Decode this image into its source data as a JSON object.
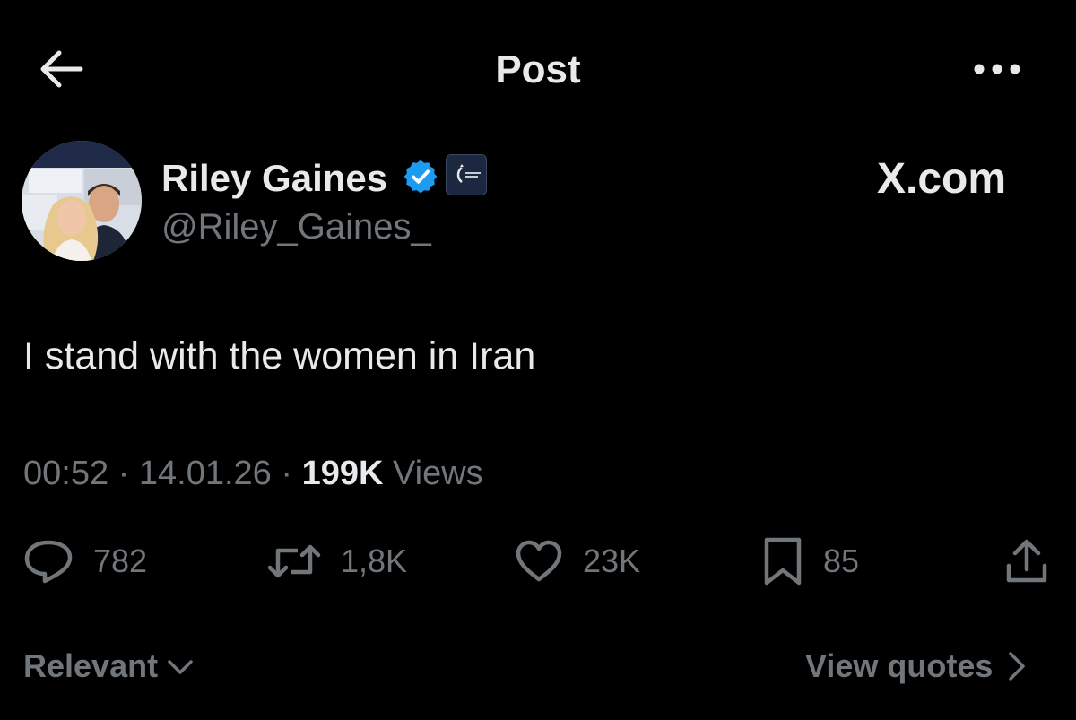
{
  "header": {
    "title": "Post",
    "back_icon": "arrow-left-icon",
    "more_icon": "more-horizontal-icon"
  },
  "author": {
    "name": "Riley Gaines",
    "handle": "@Riley_Gaines_",
    "verified_icon": "verified-badge-icon",
    "verified_color": "#1d9bf0",
    "affiliate_badge_icon": "organization-badge-icon"
  },
  "watermark": "X.com",
  "post": {
    "text": "I stand with the women in Iran",
    "time": "00:52",
    "date": "14.01.26",
    "separator": "·",
    "views_count": "199K",
    "views_label": "Views"
  },
  "actions": {
    "replies": {
      "icon": "reply-icon",
      "count": "782"
    },
    "reposts": {
      "icon": "repost-icon",
      "count": "1,8K"
    },
    "likes": {
      "icon": "heart-icon",
      "count": "23K"
    },
    "bookmarks": {
      "icon": "bookmark-icon",
      "count": "85"
    },
    "share": {
      "icon": "share-icon"
    }
  },
  "footer": {
    "sort_label": "Relevant",
    "view_quotes_label": "View quotes"
  },
  "colors": {
    "background": "#000000",
    "primary_text": "#e7e9ea",
    "secondary_text": "#71767b",
    "accent": "#1d9bf0"
  }
}
